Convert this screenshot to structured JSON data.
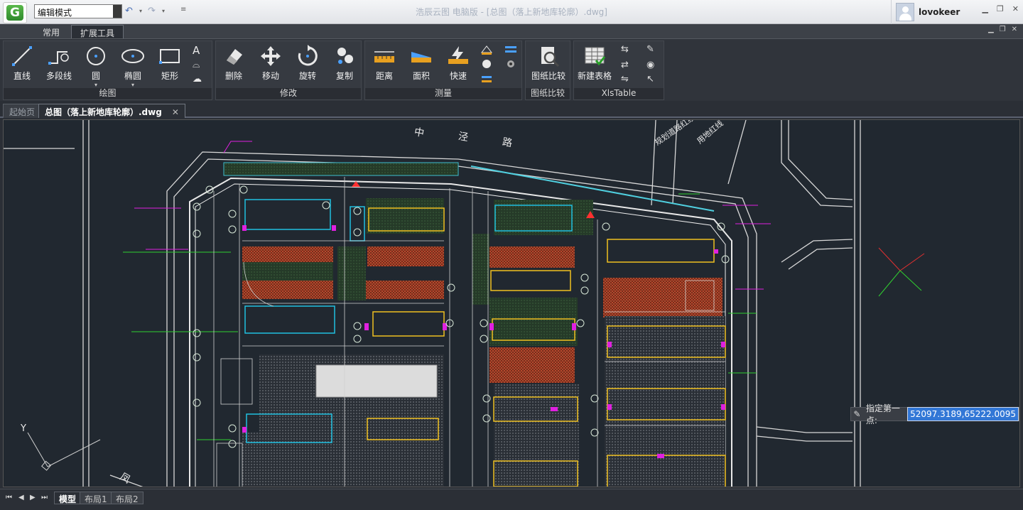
{
  "titlebar": {
    "mode_value": "编辑模式",
    "title": "浩辰云图 电脑版 - [总图（落上新地库轮廓）.dwg]",
    "username": "lovokeer",
    "logo_letter": "G"
  },
  "ribbon_tabs": [
    {
      "label": "常用",
      "active": false
    },
    {
      "label": "扩展工具",
      "active": true
    }
  ],
  "groups": {
    "draw": {
      "label": "绘图",
      "tools": [
        "直线",
        "多段线",
        "圆",
        "椭圆",
        "矩形"
      ]
    },
    "modify": {
      "label": "修改",
      "tools": [
        "删除",
        "移动",
        "旋转",
        "复制"
      ]
    },
    "measure": {
      "label": "测量",
      "tools": [
        "距离",
        "面积",
        "快速"
      ]
    },
    "compare": {
      "label": "图纸比较",
      "tools": [
        "图纸比较"
      ]
    },
    "xlstable": {
      "label": "XlsTable",
      "tools": [
        "新建表格"
      ]
    }
  },
  "doc_tabs": [
    {
      "label": "起始页",
      "active": false
    },
    {
      "label": "总图（落上新地库轮廓）.dwg",
      "active": true
    }
  ],
  "command": {
    "prompt": "指定第一点:",
    "value": "52097.3189,65222.0095"
  },
  "drawing_text": {
    "road_char_1": "中",
    "road_char_2": "泾",
    "road_char_3": "路",
    "road_label_1": "规划道路红线",
    "road_label_2": "用地红线",
    "axis_y": "Y",
    "corner_char": "凤"
  },
  "layout_tabs": [
    {
      "label": "模型",
      "active": true
    },
    {
      "label": "布局1",
      "active": false
    },
    {
      "label": "布局2",
      "active": false
    }
  ],
  "colors": {
    "canvas_bg": "#212830",
    "accent_blue": "#3277d6",
    "hatch_red": "#c8422a",
    "hatch_green": "#2f5a2f",
    "building_yellow": "#f0c020",
    "building_cyan": "#20c0e0",
    "magenta": "#e020e0"
  }
}
